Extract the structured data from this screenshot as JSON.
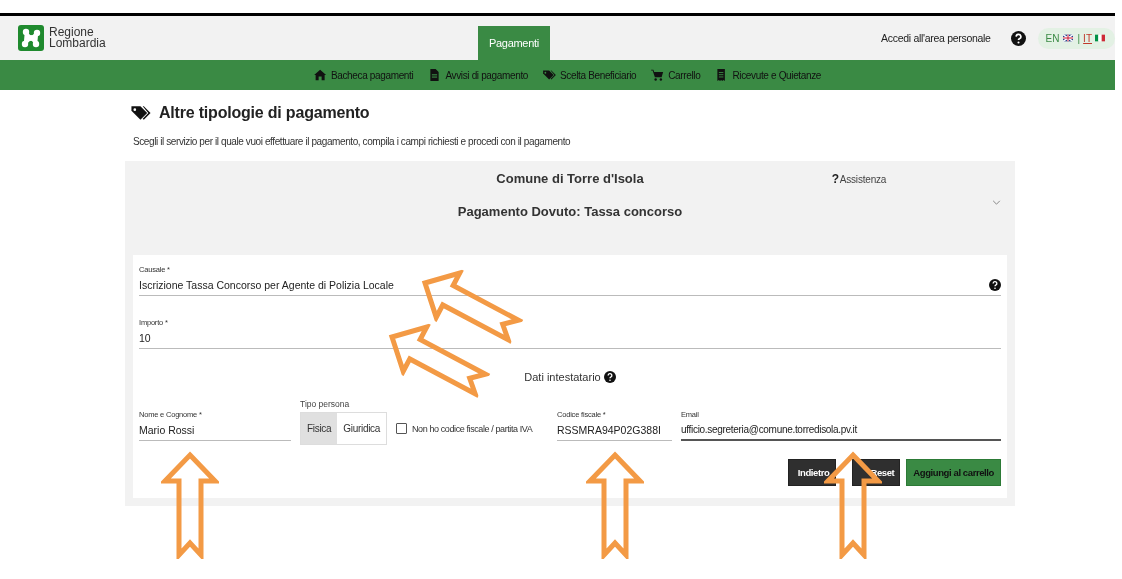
{
  "header": {
    "logo_lines": [
      "Regione",
      "Lombardia"
    ],
    "tab": {
      "label": "Pagamenti",
      "selected": true
    },
    "login_link": "Accedi all'area personale",
    "languages": [
      {
        "label": "EN",
        "kind": "uk",
        "selected": false
      },
      {
        "label": "IT",
        "kind": "it",
        "selected": true
      }
    ],
    "language_separator": "|"
  },
  "nav": [
    {
      "label": "Bacheca pagamenti",
      "kind": "home"
    },
    {
      "label": "Avvisi di pagamento",
      "kind": "document"
    },
    {
      "label": "Scelta Beneficiario",
      "kind": "tags"
    },
    {
      "label": "Carrello",
      "kind": "cart"
    },
    {
      "label": "Ricevute e Quietanze",
      "kind": "receipt"
    }
  ],
  "page": {
    "title": "Altre tipologie di pagamento",
    "intro": "Scegli il servizio per il quale vuoi effettuare il pagamento, compila i campi richiesti e procedi con il pagamento"
  },
  "panel": {
    "entity": "Comune di Torre d'Isola",
    "help_icon": "?",
    "help": "Assistenza",
    "service": "Pagamento Dovuto: Tassa concorso",
    "fields": [
      {
        "label": "Causale *",
        "value": "Iscrizione Tassa Concorso per Agente di Polizia Locale",
        "help": true
      },
      {
        "label": "Importo *",
        "value": "10",
        "help": false
      }
    ],
    "section_title": "Dati intestatario",
    "holder": {
      "name": {
        "label": "Nome e Cognome *",
        "value": "Mario Rossi"
      },
      "person_type": {
        "label": "Tipo persona",
        "options": [
          {
            "label": "Fisica",
            "selected": true
          },
          {
            "label": "Giuridica",
            "selected": false
          }
        ]
      },
      "no_tax_code": {
        "label": "Non ho codice fiscale / partita IVA",
        "checked": false
      },
      "tax_code": {
        "label": "Codice fiscale *",
        "value": "RSSMRA94P02G388I"
      },
      "email": {
        "label": "Email",
        "value": "ufficio.segreteria@comune.torredisola.pv.it",
        "focused": true
      }
    },
    "buttons": [
      {
        "label": "Indietro",
        "kind": "dark"
      },
      {
        "label": "Reset",
        "kind": "dark"
      },
      {
        "label": "Aggiungi al carrello",
        "kind": "primary"
      }
    ]
  }
}
